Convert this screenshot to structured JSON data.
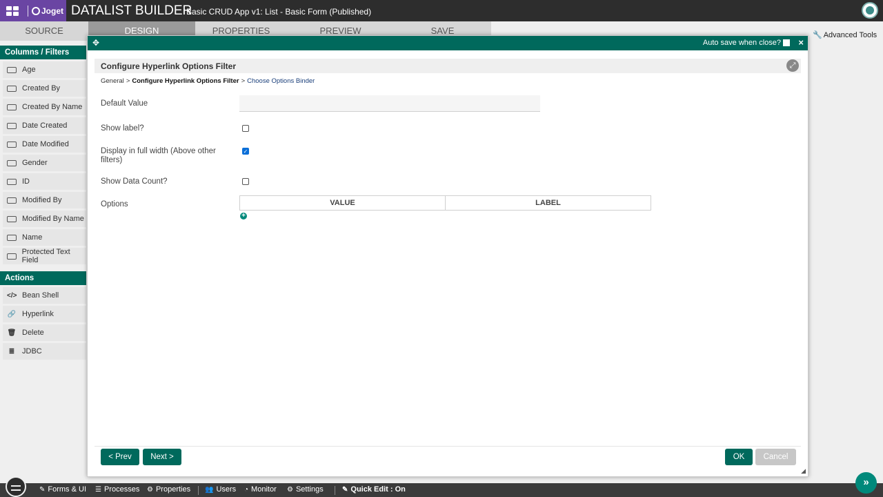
{
  "header": {
    "logo_text": "Joget",
    "builder_title": "DATALIST BUILDER",
    "app_subtitle": "Basic CRUD App v1: List - Basic Form (Published)"
  },
  "steps": [
    "SOURCE",
    "DESIGN",
    "PROPERTIES",
    "PREVIEW",
    "SAVE"
  ],
  "toolbar": {
    "advanced_tools": "Advanced Tools"
  },
  "sidebar": {
    "columns_title": "Columns / Filters",
    "columns": [
      "Age",
      "Created By",
      "Created By Name",
      "Date Created",
      "Date Modified",
      "Gender",
      "ID",
      "Modified By",
      "Modified By Name",
      "Name",
      "Protected Text Field"
    ],
    "actions_title": "Actions",
    "actions": [
      {
        "label": "Bean Shell",
        "icon": "code-icon"
      },
      {
        "label": "Hyperlink",
        "icon": "link-icon"
      },
      {
        "label": "Delete",
        "icon": "trash-icon"
      },
      {
        "label": "JDBC",
        "icon": "database-icon"
      }
    ]
  },
  "dialog": {
    "autosave_label": "Auto save when close?",
    "title": "Configure Hyperlink Options Filter",
    "breadcrumb": {
      "first": "General",
      "current": "Configure Hyperlink Options Filter",
      "next": "Choose Options Binder"
    },
    "fields": {
      "default_value_label": "Default Value",
      "default_value": "",
      "show_label_label": "Show label?",
      "full_width_label": "Display in full width (Above other filters)",
      "show_count_label": "Show Data Count?",
      "options_label": "Options"
    },
    "options_table": {
      "columns": [
        "VALUE",
        "LABEL"
      ]
    },
    "buttons": {
      "prev": "< Prev",
      "next": "Next >",
      "ok": "OK",
      "cancel": "Cancel"
    }
  },
  "bottombar": {
    "items": [
      "Forms & UI",
      "Processes",
      "Properties",
      "Users",
      "Monitor",
      "Settings"
    ],
    "quick_edit": "Quick Edit : On"
  },
  "colors": {
    "primary": "#00695c",
    "accent": "#00897b",
    "header": "#2d2d2d",
    "logo_bg": "#6a45a3"
  }
}
